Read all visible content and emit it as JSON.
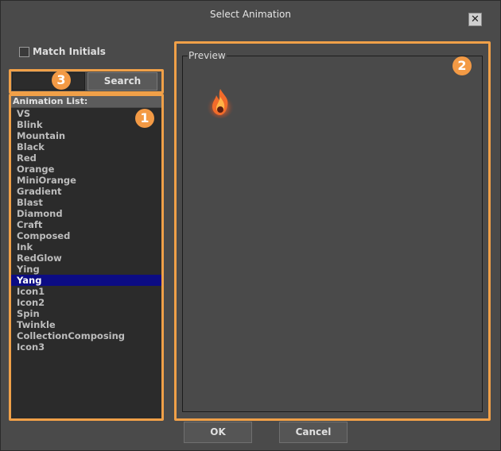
{
  "window": {
    "title": "Select Animation",
    "close_symbol": "✕"
  },
  "filter": {
    "match_initials_label": "Match Initials",
    "match_initials_checked": false
  },
  "search": {
    "value": "",
    "button_label": "Search"
  },
  "list": {
    "header": "Animation List:",
    "items": [
      "VS",
      "Blink",
      "Mountain",
      "Black",
      "Red",
      "Orange",
      "MiniOrange",
      "Gradient",
      "Blast",
      "Diamond",
      "Craft",
      "Composed",
      "Ink",
      "RedGlow",
      "Ying",
      "Yang",
      "Icon1",
      "Icon2",
      "Spin",
      "Twinkle",
      "CollectionComposing",
      "Icon3"
    ],
    "selected": "Yang"
  },
  "preview": {
    "label": "Preview",
    "icon": "flame-icon"
  },
  "footer": {
    "ok_label": "OK",
    "cancel_label": "Cancel"
  },
  "annotations": {
    "badges": [
      "1",
      "2",
      "3"
    ],
    "color": "#f39a45"
  }
}
